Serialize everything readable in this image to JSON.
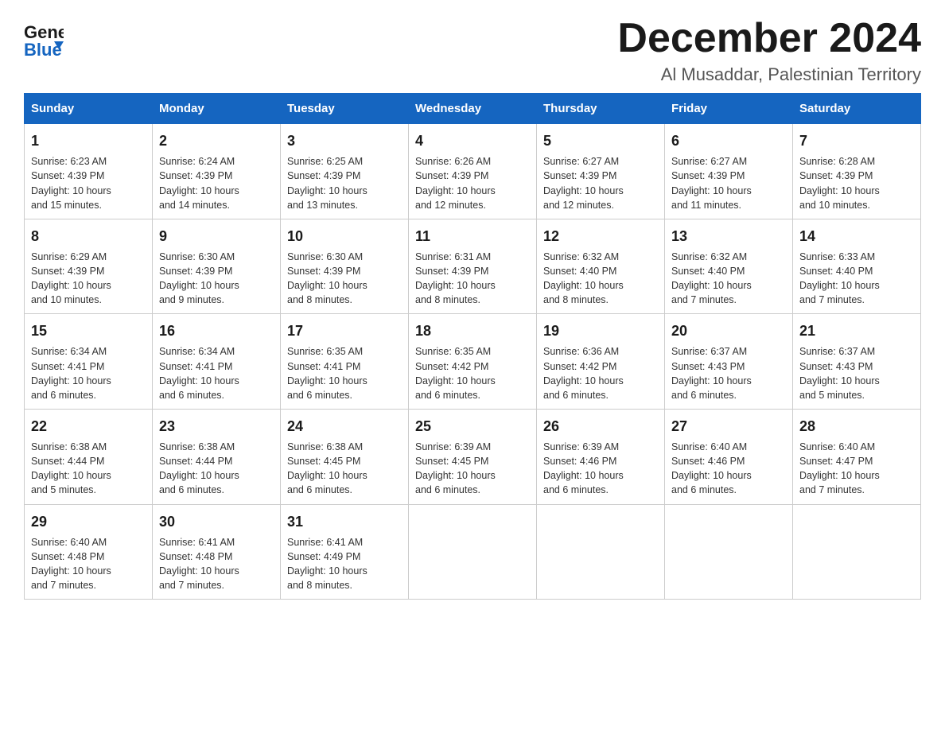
{
  "logo": {
    "general": "General",
    "blue": "Blue"
  },
  "header": {
    "month": "December 2024",
    "location": "Al Musaddar, Palestinian Territory"
  },
  "days_of_week": [
    "Sunday",
    "Monday",
    "Tuesday",
    "Wednesday",
    "Thursday",
    "Friday",
    "Saturday"
  ],
  "weeks": [
    [
      {
        "day": "1",
        "sunrise": "6:23 AM",
        "sunset": "4:39 PM",
        "daylight": "10 hours and 15 minutes."
      },
      {
        "day": "2",
        "sunrise": "6:24 AM",
        "sunset": "4:39 PM",
        "daylight": "10 hours and 14 minutes."
      },
      {
        "day": "3",
        "sunrise": "6:25 AM",
        "sunset": "4:39 PM",
        "daylight": "10 hours and 13 minutes."
      },
      {
        "day": "4",
        "sunrise": "6:26 AM",
        "sunset": "4:39 PM",
        "daylight": "10 hours and 12 minutes."
      },
      {
        "day": "5",
        "sunrise": "6:27 AM",
        "sunset": "4:39 PM",
        "daylight": "10 hours and 12 minutes."
      },
      {
        "day": "6",
        "sunrise": "6:27 AM",
        "sunset": "4:39 PM",
        "daylight": "10 hours and 11 minutes."
      },
      {
        "day": "7",
        "sunrise": "6:28 AM",
        "sunset": "4:39 PM",
        "daylight": "10 hours and 10 minutes."
      }
    ],
    [
      {
        "day": "8",
        "sunrise": "6:29 AM",
        "sunset": "4:39 PM",
        "daylight": "10 hours and 10 minutes."
      },
      {
        "day": "9",
        "sunrise": "6:30 AM",
        "sunset": "4:39 PM",
        "daylight": "10 hours and 9 minutes."
      },
      {
        "day": "10",
        "sunrise": "6:30 AM",
        "sunset": "4:39 PM",
        "daylight": "10 hours and 8 minutes."
      },
      {
        "day": "11",
        "sunrise": "6:31 AM",
        "sunset": "4:39 PM",
        "daylight": "10 hours and 8 minutes."
      },
      {
        "day": "12",
        "sunrise": "6:32 AM",
        "sunset": "4:40 PM",
        "daylight": "10 hours and 8 minutes."
      },
      {
        "day": "13",
        "sunrise": "6:32 AM",
        "sunset": "4:40 PM",
        "daylight": "10 hours and 7 minutes."
      },
      {
        "day": "14",
        "sunrise": "6:33 AM",
        "sunset": "4:40 PM",
        "daylight": "10 hours and 7 minutes."
      }
    ],
    [
      {
        "day": "15",
        "sunrise": "6:34 AM",
        "sunset": "4:41 PM",
        "daylight": "10 hours and 6 minutes."
      },
      {
        "day": "16",
        "sunrise": "6:34 AM",
        "sunset": "4:41 PM",
        "daylight": "10 hours and 6 minutes."
      },
      {
        "day": "17",
        "sunrise": "6:35 AM",
        "sunset": "4:41 PM",
        "daylight": "10 hours and 6 minutes."
      },
      {
        "day": "18",
        "sunrise": "6:35 AM",
        "sunset": "4:42 PM",
        "daylight": "10 hours and 6 minutes."
      },
      {
        "day": "19",
        "sunrise": "6:36 AM",
        "sunset": "4:42 PM",
        "daylight": "10 hours and 6 minutes."
      },
      {
        "day": "20",
        "sunrise": "6:37 AM",
        "sunset": "4:43 PM",
        "daylight": "10 hours and 6 minutes."
      },
      {
        "day": "21",
        "sunrise": "6:37 AM",
        "sunset": "4:43 PM",
        "daylight": "10 hours and 5 minutes."
      }
    ],
    [
      {
        "day": "22",
        "sunrise": "6:38 AM",
        "sunset": "4:44 PM",
        "daylight": "10 hours and 5 minutes."
      },
      {
        "day": "23",
        "sunrise": "6:38 AM",
        "sunset": "4:44 PM",
        "daylight": "10 hours and 6 minutes."
      },
      {
        "day": "24",
        "sunrise": "6:38 AM",
        "sunset": "4:45 PM",
        "daylight": "10 hours and 6 minutes."
      },
      {
        "day": "25",
        "sunrise": "6:39 AM",
        "sunset": "4:45 PM",
        "daylight": "10 hours and 6 minutes."
      },
      {
        "day": "26",
        "sunrise": "6:39 AM",
        "sunset": "4:46 PM",
        "daylight": "10 hours and 6 minutes."
      },
      {
        "day": "27",
        "sunrise": "6:40 AM",
        "sunset": "4:46 PM",
        "daylight": "10 hours and 6 minutes."
      },
      {
        "day": "28",
        "sunrise": "6:40 AM",
        "sunset": "4:47 PM",
        "daylight": "10 hours and 7 minutes."
      }
    ],
    [
      {
        "day": "29",
        "sunrise": "6:40 AM",
        "sunset": "4:48 PM",
        "daylight": "10 hours and 7 minutes."
      },
      {
        "day": "30",
        "sunrise": "6:41 AM",
        "sunset": "4:48 PM",
        "daylight": "10 hours and 7 minutes."
      },
      {
        "day": "31",
        "sunrise": "6:41 AM",
        "sunset": "4:49 PM",
        "daylight": "10 hours and 8 minutes."
      },
      null,
      null,
      null,
      null
    ]
  ],
  "labels": {
    "sunrise": "Sunrise:",
    "sunset": "Sunset:",
    "daylight": "Daylight:"
  }
}
